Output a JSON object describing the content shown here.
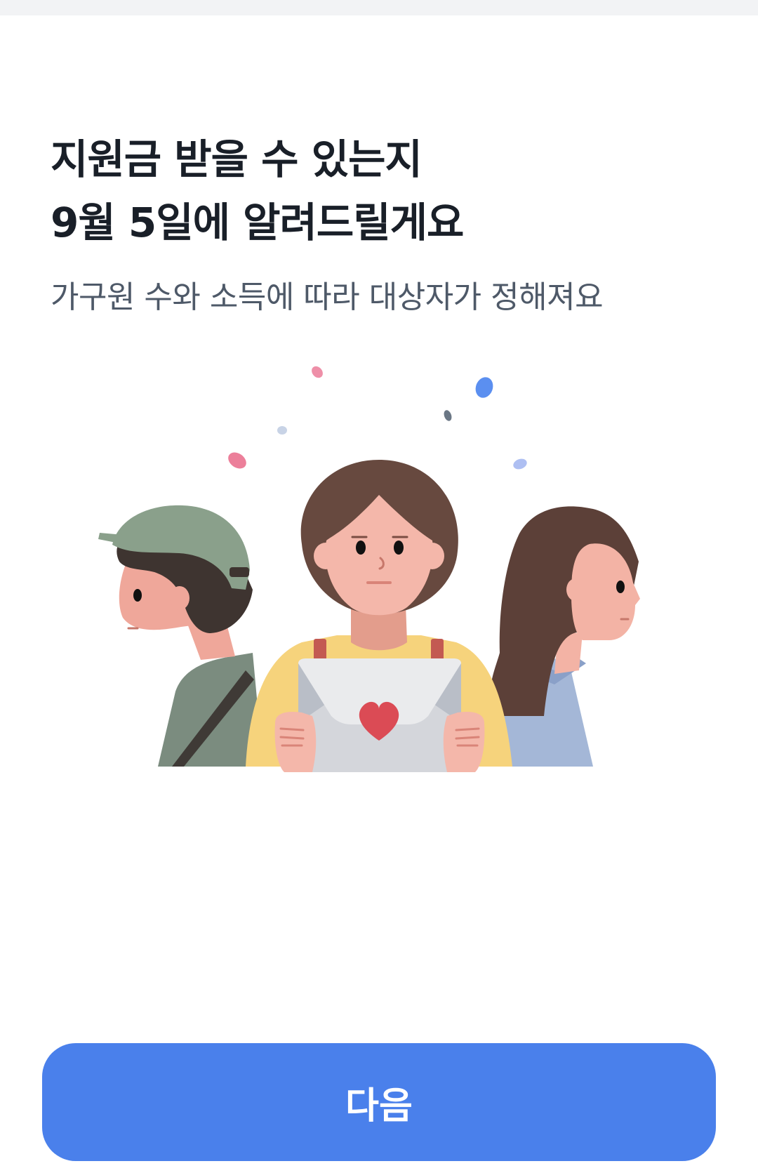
{
  "header": {
    "headline_line1": "지원금 받을 수 있는지",
    "headline_line2": "9월 5일에 알려드릴게요",
    "subtitle": "가구원 수와 소득에 따라 대상자가 정해져요"
  },
  "illustration": {
    "icon": "people-with-letter-illustration"
  },
  "footer": {
    "next_label": "다음"
  },
  "colors": {
    "accent": "#4a80eb",
    "headline": "#191f28",
    "subtitle": "#4e5968"
  }
}
